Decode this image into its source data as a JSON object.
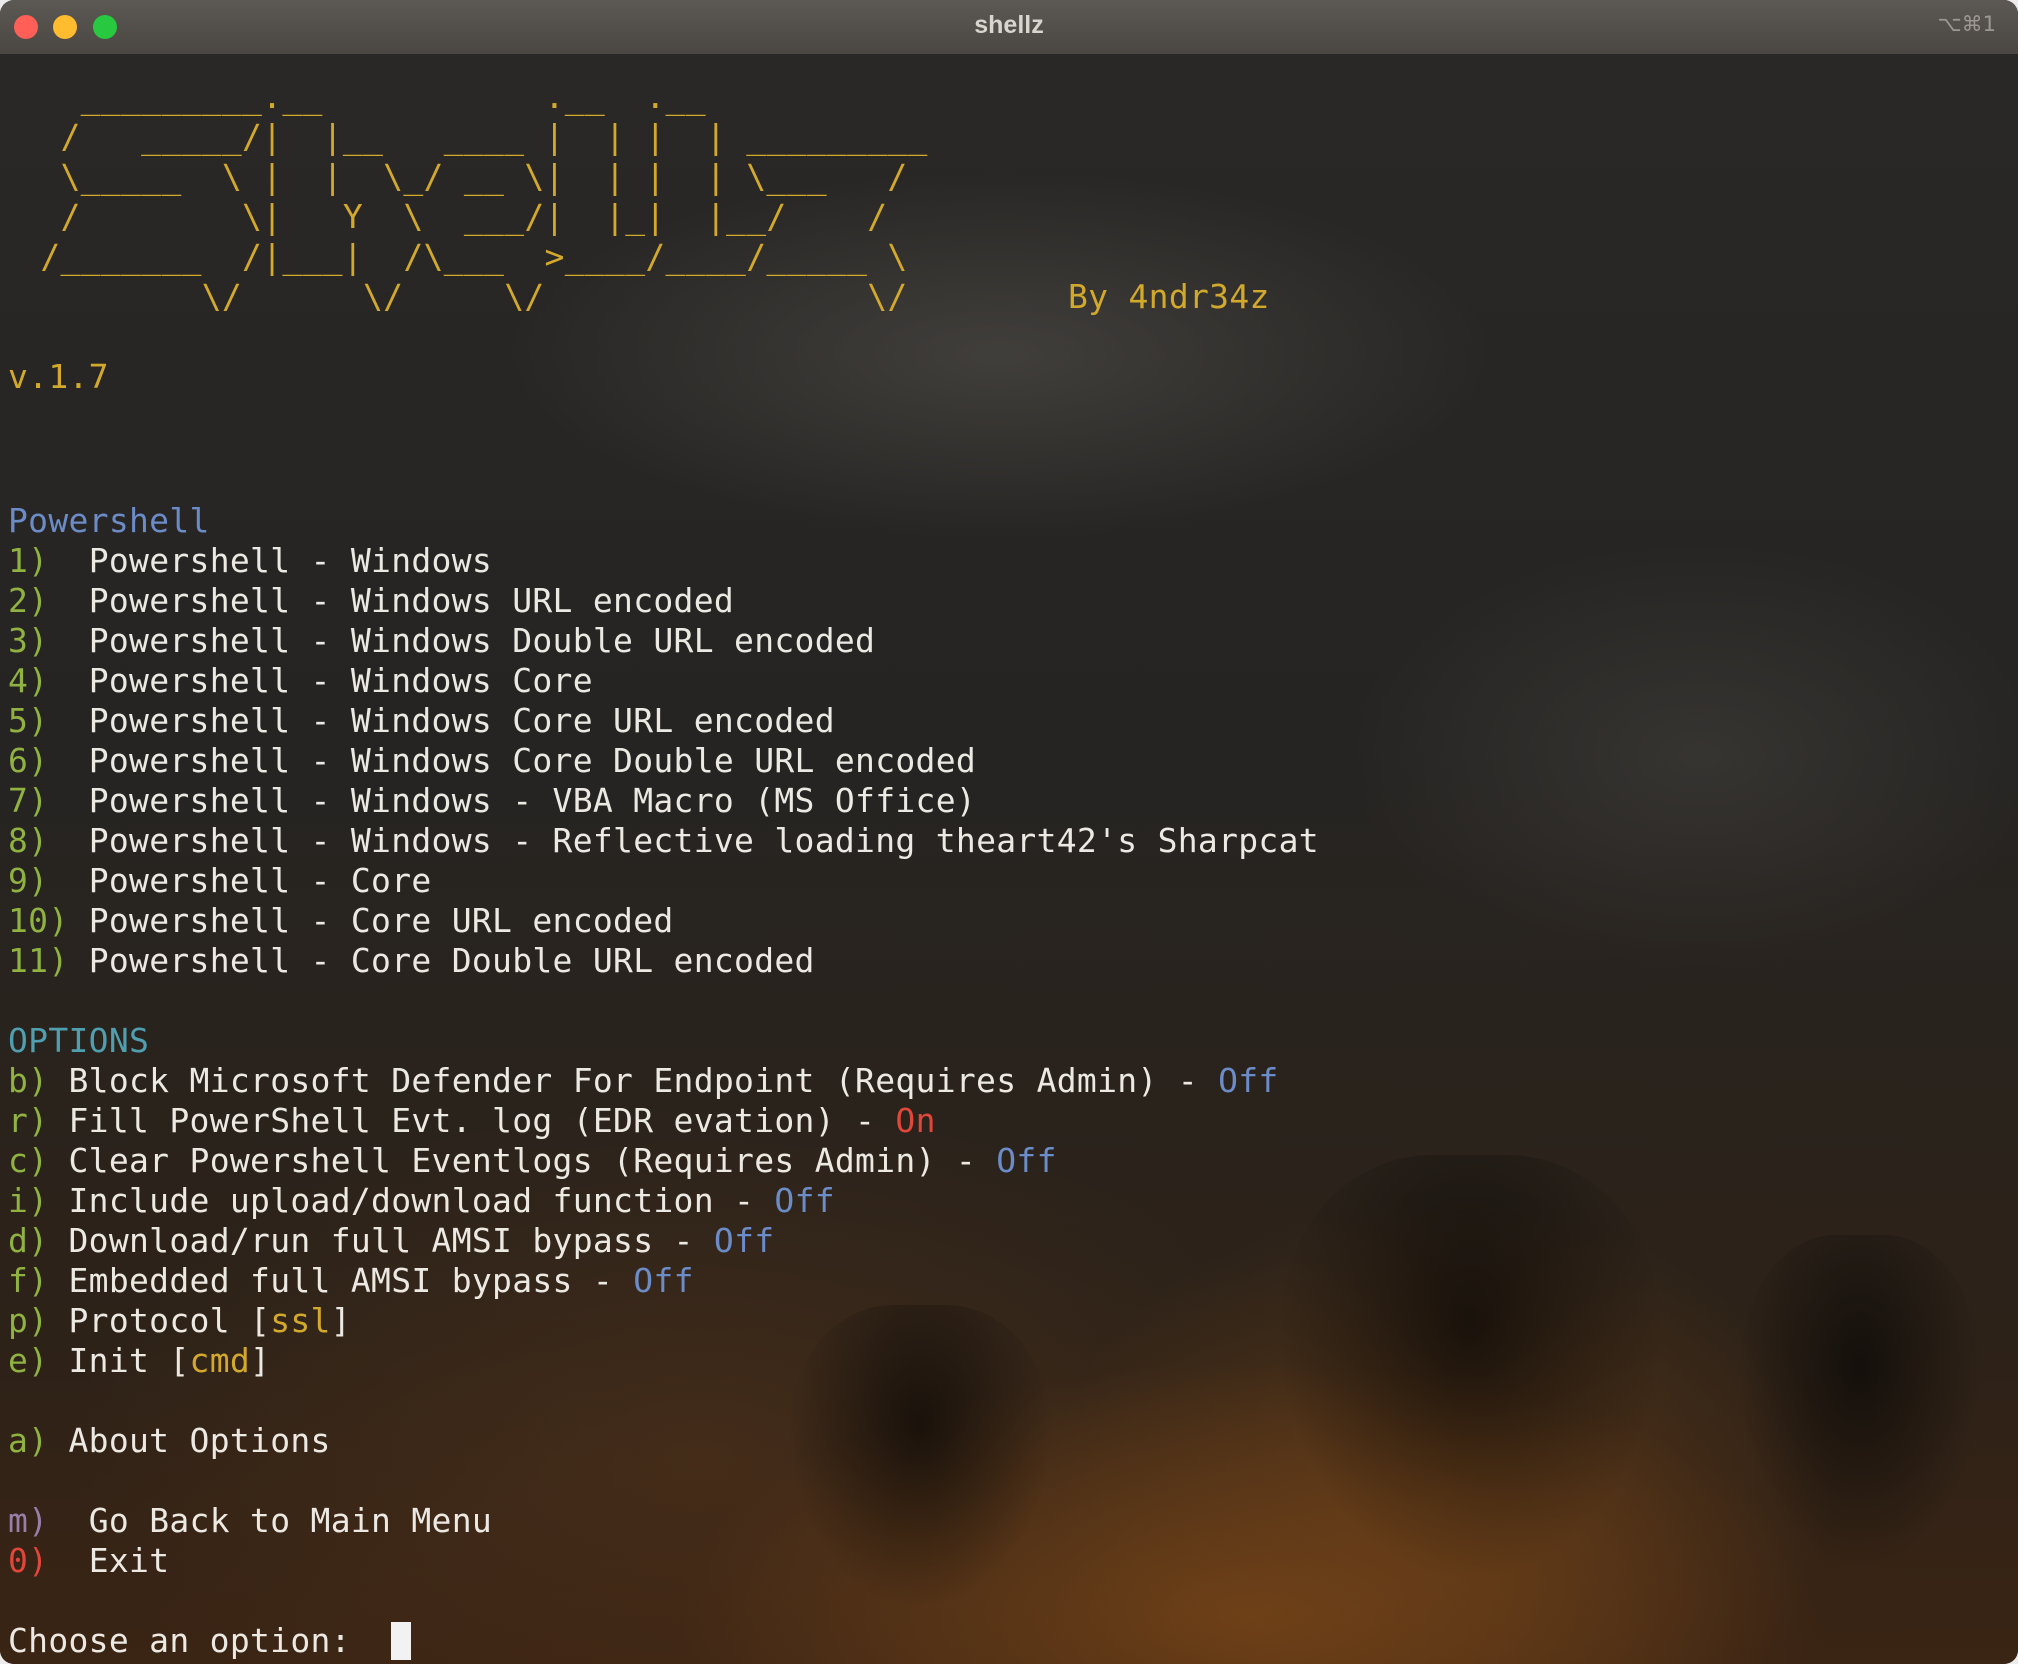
{
  "window": {
    "title": "shellz",
    "shortcut": "⌥⌘1"
  },
  "banner": {
    "art": "    _________.__           .__  .__\n   /   _____/|  |__   ____ |  | |  | _________\n   \\_____  \\ |  |  \\_/ __ \\|  | |  | \\___   /\n   /        \\|   Y  \\  ___/|  |_|  |__/    /\n  /_______  /|___|  /\\___  >____/____/_____ \\\n          \\/      \\/     \\/                \\/",
    "byline": "By 4ndr34z",
    "version": "v.1.7"
  },
  "powershell": {
    "heading": "Powershell",
    "items": [
      {
        "key": "1)",
        "pad": "  ",
        "label": "Powershell - Windows"
      },
      {
        "key": "2)",
        "pad": "  ",
        "label": "Powershell - Windows URL encoded"
      },
      {
        "key": "3)",
        "pad": "  ",
        "label": "Powershell - Windows Double URL encoded"
      },
      {
        "key": "4)",
        "pad": "  ",
        "label": "Powershell - Windows Core"
      },
      {
        "key": "5)",
        "pad": "  ",
        "label": "Powershell - Windows Core URL encoded"
      },
      {
        "key": "6)",
        "pad": "  ",
        "label": "Powershell - Windows Core Double URL encoded"
      },
      {
        "key": "7)",
        "pad": "  ",
        "label": "Powershell - Windows - VBA Macro (MS Office)"
      },
      {
        "key": "8)",
        "pad": "  ",
        "label": "Powershell - Windows - Reflective loading theart42's Sharpcat"
      },
      {
        "key": "9)",
        "pad": "  ",
        "label": "Powershell - Core"
      },
      {
        "key": "10)",
        "pad": " ",
        "label": "Powershell - Core URL encoded"
      },
      {
        "key": "11)",
        "pad": " ",
        "label": "Powershell - Core Double URL encoded"
      }
    ]
  },
  "options": {
    "heading": "OPTIONS",
    "toggles": [
      {
        "key": "b)",
        "label": "Block Microsoft Defender For Endpoint (Requires Admin)",
        "state": "Off"
      },
      {
        "key": "r)",
        "label": "Fill PowerShell Evt. log (EDR evation)",
        "state": "On"
      },
      {
        "key": "c)",
        "label": "Clear Powershell Eventlogs (Requires Admin)",
        "state": "Off"
      },
      {
        "key": "i)",
        "label": "Include upload/download function",
        "state": "Off"
      },
      {
        "key": "d)",
        "label": "Download/run full AMSI bypass",
        "state": "Off"
      },
      {
        "key": "f)",
        "label": "Embedded full AMSI bypass",
        "state": "Off"
      }
    ],
    "settings": [
      {
        "key": "p)",
        "label": "Protocol",
        "value": "ssl"
      },
      {
        "key": "e)",
        "label": "Init",
        "value": "cmd"
      }
    ],
    "about": {
      "key": "a)",
      "label": "About Options"
    }
  },
  "nav": {
    "back": {
      "key": "m)",
      "label": "Go Back to Main Menu"
    },
    "exit": {
      "key": "0)",
      "label": "Exit"
    }
  },
  "prompt": {
    "text": "Choose an option: "
  },
  "colors": {
    "gold": "#d3a92c",
    "green": "#8fb241",
    "blue": "#6b8cc7",
    "teal": "#4f9fb0",
    "red": "#e0463a",
    "purple": "#9a7ea8"
  }
}
